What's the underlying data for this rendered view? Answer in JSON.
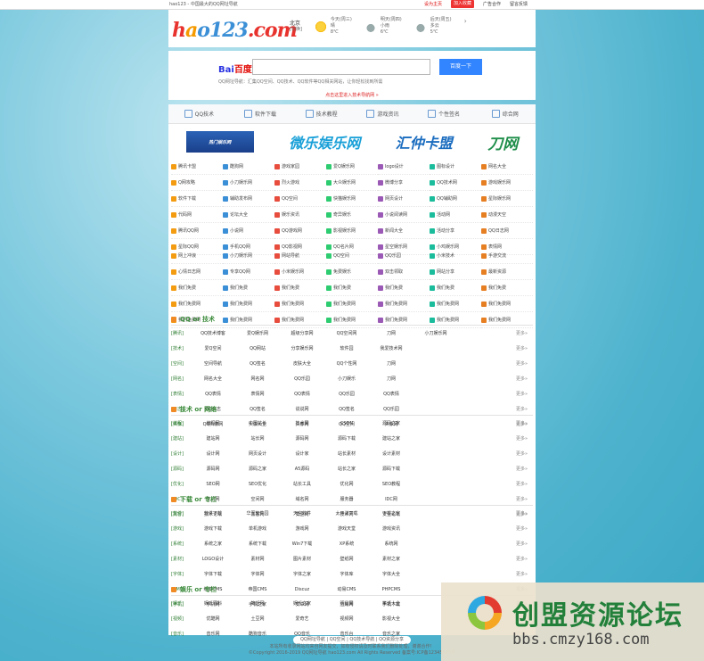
{
  "topbar": {
    "site_title": "hao123 - 中国最大的QQ网址导航",
    "link_red": "设为主页",
    "link_badge": "加入收藏",
    "link_ad": "广告合作",
    "link_feedback": "留言反馈"
  },
  "logo": {
    "p1": "h",
    "p2": "a",
    "p3": "o123",
    "p4": ".com"
  },
  "weather": {
    "city": "北京",
    "district": "[切换]",
    "days": [
      {
        "label": "今天(周三)",
        "desc": "晴",
        "temp": "8℃"
      },
      {
        "label": "明天(周四)",
        "desc": "小雨",
        "temp": "6℃"
      },
      {
        "label": "后天(周五)",
        "desc": "多云",
        "temp": "5℃"
      }
    ],
    "next": "›"
  },
  "search": {
    "brand_a": "Bai",
    "brand_b": "百度",
    "placeholder": "",
    "button": "百度一下",
    "hint": "QQ网址导航：汇集QQ空间、QQ技术、QQ软件等QQ相关网站，让你轻松找到所需",
    "notice": "点击这里进入技术导航网 »"
  },
  "tabs": [
    "QQ技术",
    "软件下载",
    "技术教程",
    "游戏资讯",
    "个性签名",
    "综合网"
  ],
  "banners": {
    "b1": "热门娱乐网",
    "b2": "微乐娱乐网",
    "b3": "汇仲卡盟",
    "b4": "刀网"
  },
  "grid1": [
    "腾讯卡盟",
    "酷狗网",
    "游戏家园",
    "爱Q娱乐网",
    "logo设计",
    "图标设计",
    "网名大全",
    "Q网攻略",
    "小刀娱乐网",
    "烈火游戏",
    "大众娱乐网",
    "微博分享",
    "QQ技术网",
    "游戏娱乐网",
    "软件下载",
    "辅助发布网",
    "QQ空间",
    "快猫娱乐网",
    "网页设计",
    "QQ辅助网",
    "星际娱乐网",
    "代码网",
    "论坛大全",
    "娱乐资讯",
    "奇异娱乐",
    "小说阅读网",
    "活动网",
    "动漫天空",
    "腾讯QQ网",
    "小说网",
    "QQ游戏网",
    "影视娱乐网",
    "新闻大全",
    "活动分享",
    "QQ日志网",
    "星际QQ网",
    "手机QQ网",
    "QQ影视网",
    "QQ名片网",
    "星空娱乐网",
    "小鸡娱乐网",
    "表情网"
  ],
  "grid2": [
    "网上冲浪",
    "小刀娱乐网",
    "网站导航",
    "QQ空间",
    "QQ乐园",
    "小米技术",
    "手游交流",
    "心情日志网",
    "专享QQ网",
    "小米娱乐网",
    "免费娱乐",
    "双击领取",
    "网站分享",
    "最新资源",
    "我们免费",
    "我们免费",
    "我们免费",
    "我们免费",
    "我们免费",
    "我们免费",
    "我们免费",
    "我们免费网",
    "我们免费网",
    "我们免费网",
    "我们免费网",
    "我们免费网",
    "我们免费网",
    "我们免费网",
    "我们免费网",
    "我们免费网",
    "我们免费网",
    "我们免费网",
    "我们免费网",
    "我们免费网",
    "我们免费网"
  ],
  "sections": [
    {
      "title": "QQ or 技术",
      "rows": [
        {
          "cat": "[腾讯]",
          "items": [
            "QQ技术博客",
            "爱Q娱乐网",
            "超级分享网",
            "QQ空间网",
            "刀网",
            "小刀娱乐网"
          ]
        },
        {
          "cat": "[技术]",
          "items": [
            "爱Q空间",
            "QQ网站",
            "分享娱乐网",
            "软件园",
            "我爱技术网",
            ""
          ]
        },
        {
          "cat": "[空间]",
          "items": [
            "空间导航",
            "QQ签名",
            "皮肤大全",
            "QQ个性网",
            "刀网",
            ""
          ]
        },
        {
          "cat": "[网名]",
          "items": [
            "网名大全",
            "网名网",
            "QQ乐园",
            "小刀娱乐",
            "刀网",
            ""
          ]
        },
        {
          "cat": "[表情]",
          "items": [
            "QQ表情",
            "表情网",
            "QQ表情",
            "QQ乐园",
            "QQ表情",
            ""
          ]
        },
        {
          "cat": "[日志]",
          "items": [
            "QQ日志",
            "QQ签名",
            "说说网",
            "QQ签名",
            "QQ乐园",
            ""
          ]
        },
        {
          "cat": "[头像]",
          "items": [
            "QQ头像网",
            "头像大全",
            "头像网",
            "QQ空间",
            "头像网",
            ""
          ]
        }
      ]
    },
    {
      "title": "技术 or 网络",
      "rows": [
        {
          "cat": "[编程]",
          "items": [
            "编程网",
            "中国站长",
            "技术网",
            "CSDN",
            "源码之家",
            ""
          ]
        },
        {
          "cat": "[建站]",
          "items": [
            "建站网",
            "站长网",
            "源码网",
            "源码下载",
            "建站之家",
            ""
          ]
        },
        {
          "cat": "[设计]",
          "items": [
            "设计网",
            "网页设计",
            "设计家",
            "站长素材",
            "设计素材",
            ""
          ]
        },
        {
          "cat": "[源码]",
          "items": [
            "源码网",
            "源码之家",
            "A5源码",
            "站长之家",
            "源码下载",
            ""
          ]
        },
        {
          "cat": "[优化]",
          "items": [
            "SEO网",
            "SEO优化",
            "站长工具",
            "优化网",
            "SEO教程",
            ""
          ]
        },
        {
          "cat": "[IDC]",
          "items": [
            "主机网",
            "空间网",
            "域名网",
            "服务器",
            "IDC网",
            ""
          ]
        },
        {
          "cat": "[黑客]",
          "items": [
            "技术论坛",
            "黑客网",
            "安全网",
            "技术网",
            "安全论坛",
            ""
          ]
        }
      ]
    },
    {
      "title": "下载 or 专栏",
      "rows": [
        {
          "cat": "[软件]",
          "items": [
            "软件下载",
            "华军软件园",
            "天空软件",
            "太平洋下载",
            "下载之家",
            ""
          ]
        },
        {
          "cat": "[游戏]",
          "items": [
            "游戏下载",
            "单机游戏",
            "游戏网",
            "游戏天堂",
            "游戏资讯",
            ""
          ]
        },
        {
          "cat": "[系统]",
          "items": [
            "系统之家",
            "系统下载",
            "Win7下载",
            "XP系统",
            "系统网",
            ""
          ]
        },
        {
          "cat": "[素材]",
          "items": [
            "LOGO设计",
            "素材网",
            "图片素材",
            "壁纸网",
            "素材之家",
            ""
          ]
        },
        {
          "cat": "[字体]",
          "items": [
            "字体下载",
            "字体网",
            "字体之家",
            "字体库",
            "字体大全",
            ""
          ]
        },
        {
          "cat": "[CMS]",
          "items": [
            "织梦CMS",
            "帝国CMS",
            "Discuz",
            "动易CMS",
            "PHPCMS",
            ""
          ]
        },
        {
          "cat": "[手机]",
          "items": [
            "手机网",
            "手机之家",
            "安卓网",
            "应用网",
            "手机下载",
            ""
          ]
        }
      ]
    },
    {
      "title": "娱乐 or 专栏",
      "rows": [
        {
          "cat": "[娱乐]",
          "items": [
            "娱乐百科",
            "笑话网",
            "娱乐之家",
            "明星网",
            "笑话大全",
            ""
          ]
        },
        {
          "cat": "[视频]",
          "items": [
            "优酷网",
            "土豆网",
            "爱奇艺",
            "视频网",
            "影视大全",
            ""
          ]
        },
        {
          "cat": "[音乐]",
          "items": [
            "音乐网",
            "酷狗音乐",
            "QQ音乐",
            "音乐台",
            "音乐之家",
            ""
          ]
        }
      ]
    }
  ],
  "more_label": "更多»",
  "footer": {
    "pill": "QQ网址导航 | QQ空间 | QQ技术导航 | QQ资源分享",
    "line1": "本站所有收录网站均来自网友提交，如有侵权请及时联系我们删除处理，谢谢合作！",
    "line2": "©Copyright 2016-2019 QQ网址导航 hao123.com All Rights Reserved 备案号:ICP备12345678号"
  },
  "watermark": {
    "title": "创盟资源论坛",
    "url": "bbs.cmzy168.com"
  },
  "colors": {
    "accent": "#3385ff",
    "section_title": "#3a8a3a",
    "background": "#4db2cd"
  }
}
